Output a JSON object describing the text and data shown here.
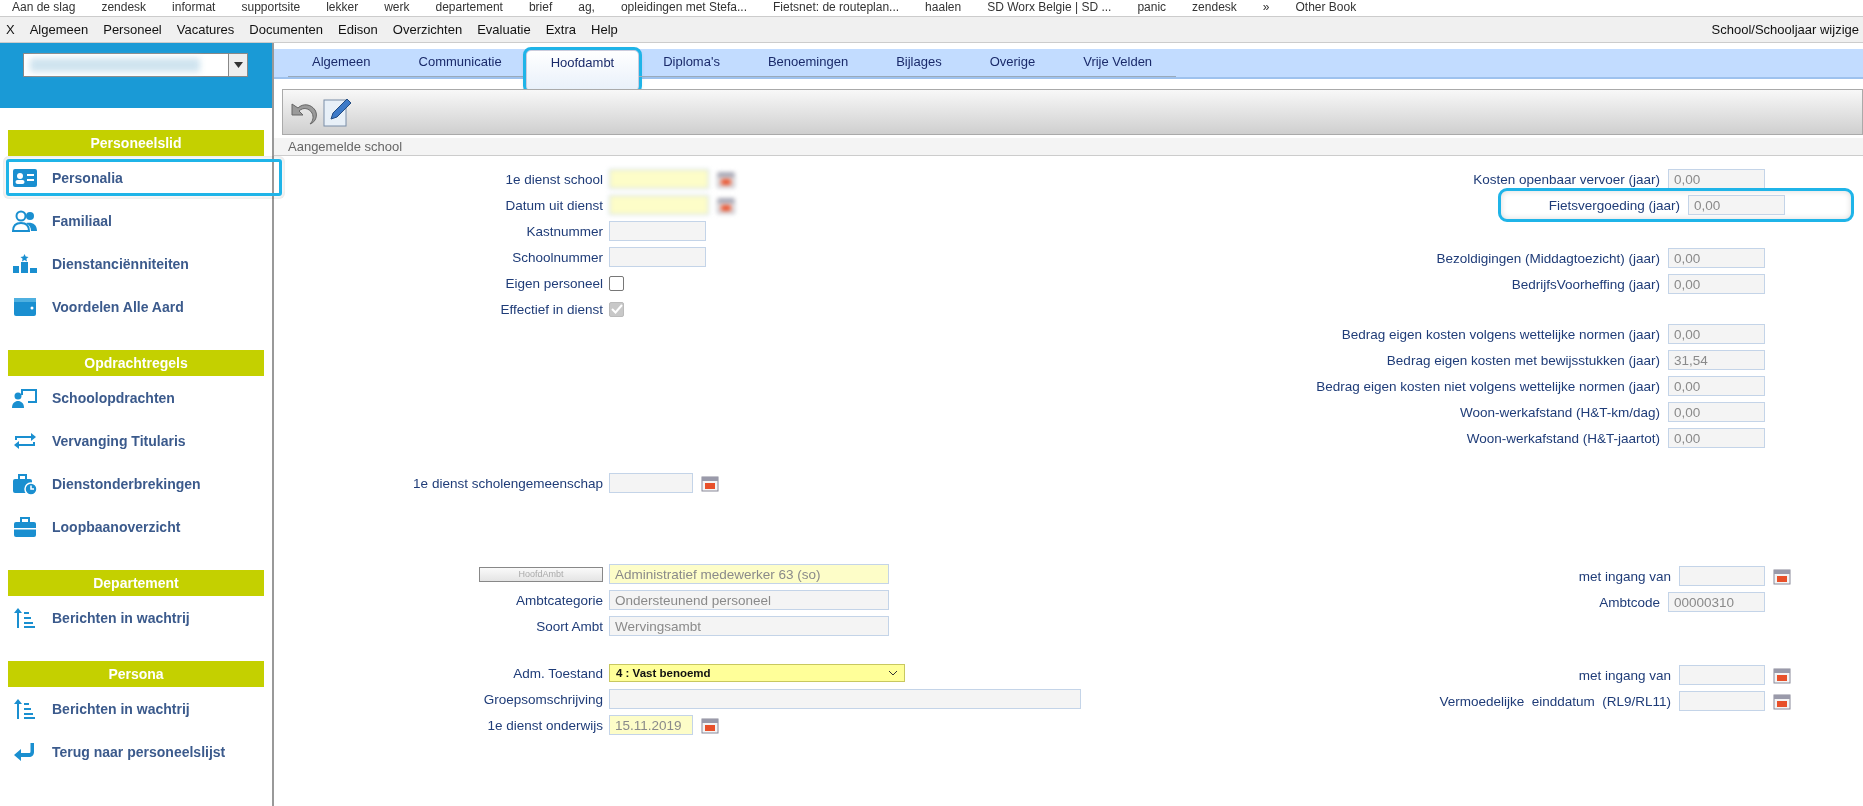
{
  "bookmarks": [
    "Aan de slag",
    "zendesk",
    "informat",
    "supportsite",
    "lekker",
    "werk",
    "departement",
    "brief",
    "ag,",
    "opleidingen met Stefa...",
    "Fietsnet: de routeplan...",
    "haalen",
    "SD Worx Belgie | SD ...",
    "panic",
    "zendesk",
    "»",
    "Other Book"
  ],
  "menu": {
    "items": [
      "X",
      "Algemeen",
      "Personeel",
      "Vacatures",
      "Documenten",
      "Edison",
      "Overzichten",
      "Evaluatie",
      "Extra",
      "Help"
    ],
    "right": "School/Schooljaar wijzige"
  },
  "sidebar": {
    "select": {
      "blurred": true
    },
    "sections": [
      {
        "title": "Personeelslid",
        "items": [
          {
            "label": "Personalia",
            "highlighted": true
          },
          {
            "label": "Familiaal",
            "highlighted": false
          },
          {
            "label": "Dienstanciënniteiten",
            "highlighted": false
          },
          {
            "label": "Voordelen Alle Aard",
            "highlighted": false
          }
        ]
      },
      {
        "title": "Opdrachtregels",
        "items": [
          {
            "label": "Schoolopdrachten",
            "highlighted": false
          },
          {
            "label": "Vervanging Titularis",
            "highlighted": false
          },
          {
            "label": "Dienstonderbrekingen",
            "highlighted": false
          },
          {
            "label": "Loopbaanoverzicht",
            "highlighted": false
          }
        ]
      },
      {
        "title": "Departement",
        "items": [
          {
            "label": "Berichten in wachtrij",
            "highlighted": false
          }
        ]
      },
      {
        "title": "Persona",
        "items": [
          {
            "label": "Berichten in wachtrij",
            "highlighted": false
          },
          {
            "label": "Terug naar personeelslijst",
            "highlighted": false
          }
        ]
      }
    ]
  },
  "tabs": [
    {
      "label": "Algemeen",
      "selected": false,
      "highlighted": false
    },
    {
      "label": "Communicatie",
      "selected": false,
      "highlighted": false
    },
    {
      "label": "Hoofdambt",
      "selected": true,
      "highlighted": true
    },
    {
      "label": "Diploma's",
      "selected": false,
      "highlighted": false
    },
    {
      "label": "Benoemingen",
      "selected": false,
      "highlighted": false
    },
    {
      "label": "Bijlages",
      "selected": false,
      "highlighted": false
    },
    {
      "label": "Overige",
      "selected": false,
      "highlighted": false
    },
    {
      "label": "Vrije Velden",
      "selected": false,
      "highlighted": false
    }
  ],
  "section_header": "Aangemelde school",
  "left_groups": [
    [
      {
        "kind": "date",
        "label": "1e dienst school",
        "required": true,
        "blurred": true
      },
      {
        "kind": "date",
        "label": "Datum uit dienst",
        "required": true,
        "blurred": true
      },
      {
        "kind": "shortfield",
        "label": "Kastnummer"
      },
      {
        "kind": "shortfield",
        "label": "Schoolnummer"
      },
      {
        "kind": "checkbox",
        "label": "Eigen personeel",
        "checked": false,
        "disabled": false
      },
      {
        "kind": "checkbox",
        "label": "Effectief in dienst",
        "checked": true,
        "disabled": true
      }
    ],
    [
      {
        "kind": "date",
        "label": "1e dienst scholengemeenschap",
        "required": false,
        "blurred": false
      }
    ],
    [
      {
        "kind": "button-field",
        "button": "HoofdAmbt",
        "value": "Administratief medewerker 63 (so)",
        "required": true
      },
      {
        "kind": "longfield",
        "label": "Ambtcategorie",
        "value": "Ondersteunend personeel"
      },
      {
        "kind": "longfield",
        "label": "Soort Ambt",
        "value": "Wervingsambt"
      }
    ],
    [
      {
        "kind": "select",
        "label": "Adm. Toestand",
        "value": "4 : Vast benoemd"
      },
      {
        "kind": "widefield",
        "label": "Groepsomschrijving"
      },
      {
        "kind": "date",
        "label": "1e dienst onderwijs",
        "value": "15.11.2019",
        "required": true,
        "blurred": false
      }
    ]
  ],
  "right_groups": [
    [
      {
        "kind": "text",
        "label": "Kosten openbaar vervoer (jaar)",
        "value": "0,00",
        "highlighted": false
      },
      {
        "kind": "text",
        "label": "Fietsvergoeding (jaar)",
        "value": "0,00",
        "highlighted": true
      }
    ],
    [
      {
        "kind": "text",
        "label": "Bezoldigingen (Middagtoezicht) (jaar)",
        "value": "0,00",
        "highlighted": false
      },
      {
        "kind": "text",
        "label": "BedrijfsVoorheffing (jaar)",
        "value": "0,00",
        "highlighted": false
      }
    ],
    [
      {
        "kind": "text",
        "label": "Bedrag eigen kosten volgens wettelijke normen (jaar)",
        "value": "0,00",
        "highlighted": false
      },
      {
        "kind": "text",
        "label": "Bedrag eigen kosten met bewijsstukken (jaar)",
        "value": "31,54",
        "highlighted": false
      },
      {
        "kind": "text",
        "label": "Bedrag eigen kosten niet volgens wettelijke normen (jaar)",
        "value": "0,00",
        "highlighted": false
      },
      {
        "kind": "text",
        "label": "Woon-werkafstand (H&T-km/dag)",
        "value": "0,00",
        "highlighted": false
      },
      {
        "kind": "text",
        "label": "Woon-werkafstand (H&T-jaartot)",
        "value": "0,00",
        "highlighted": false
      }
    ],
    [
      {
        "kind": "date",
        "label": "met ingang van",
        "highlighted": false
      },
      {
        "kind": "text",
        "label": "Ambtcode",
        "value": "00000310",
        "highlighted": false
      }
    ],
    [
      {
        "kind": "date",
        "label": "met ingang van",
        "highlighted": false
      },
      {
        "kind": "date",
        "label": "Vermoedelijke  einddatum  (RL9/RL11)",
        "highlighted": false
      }
    ]
  ]
}
